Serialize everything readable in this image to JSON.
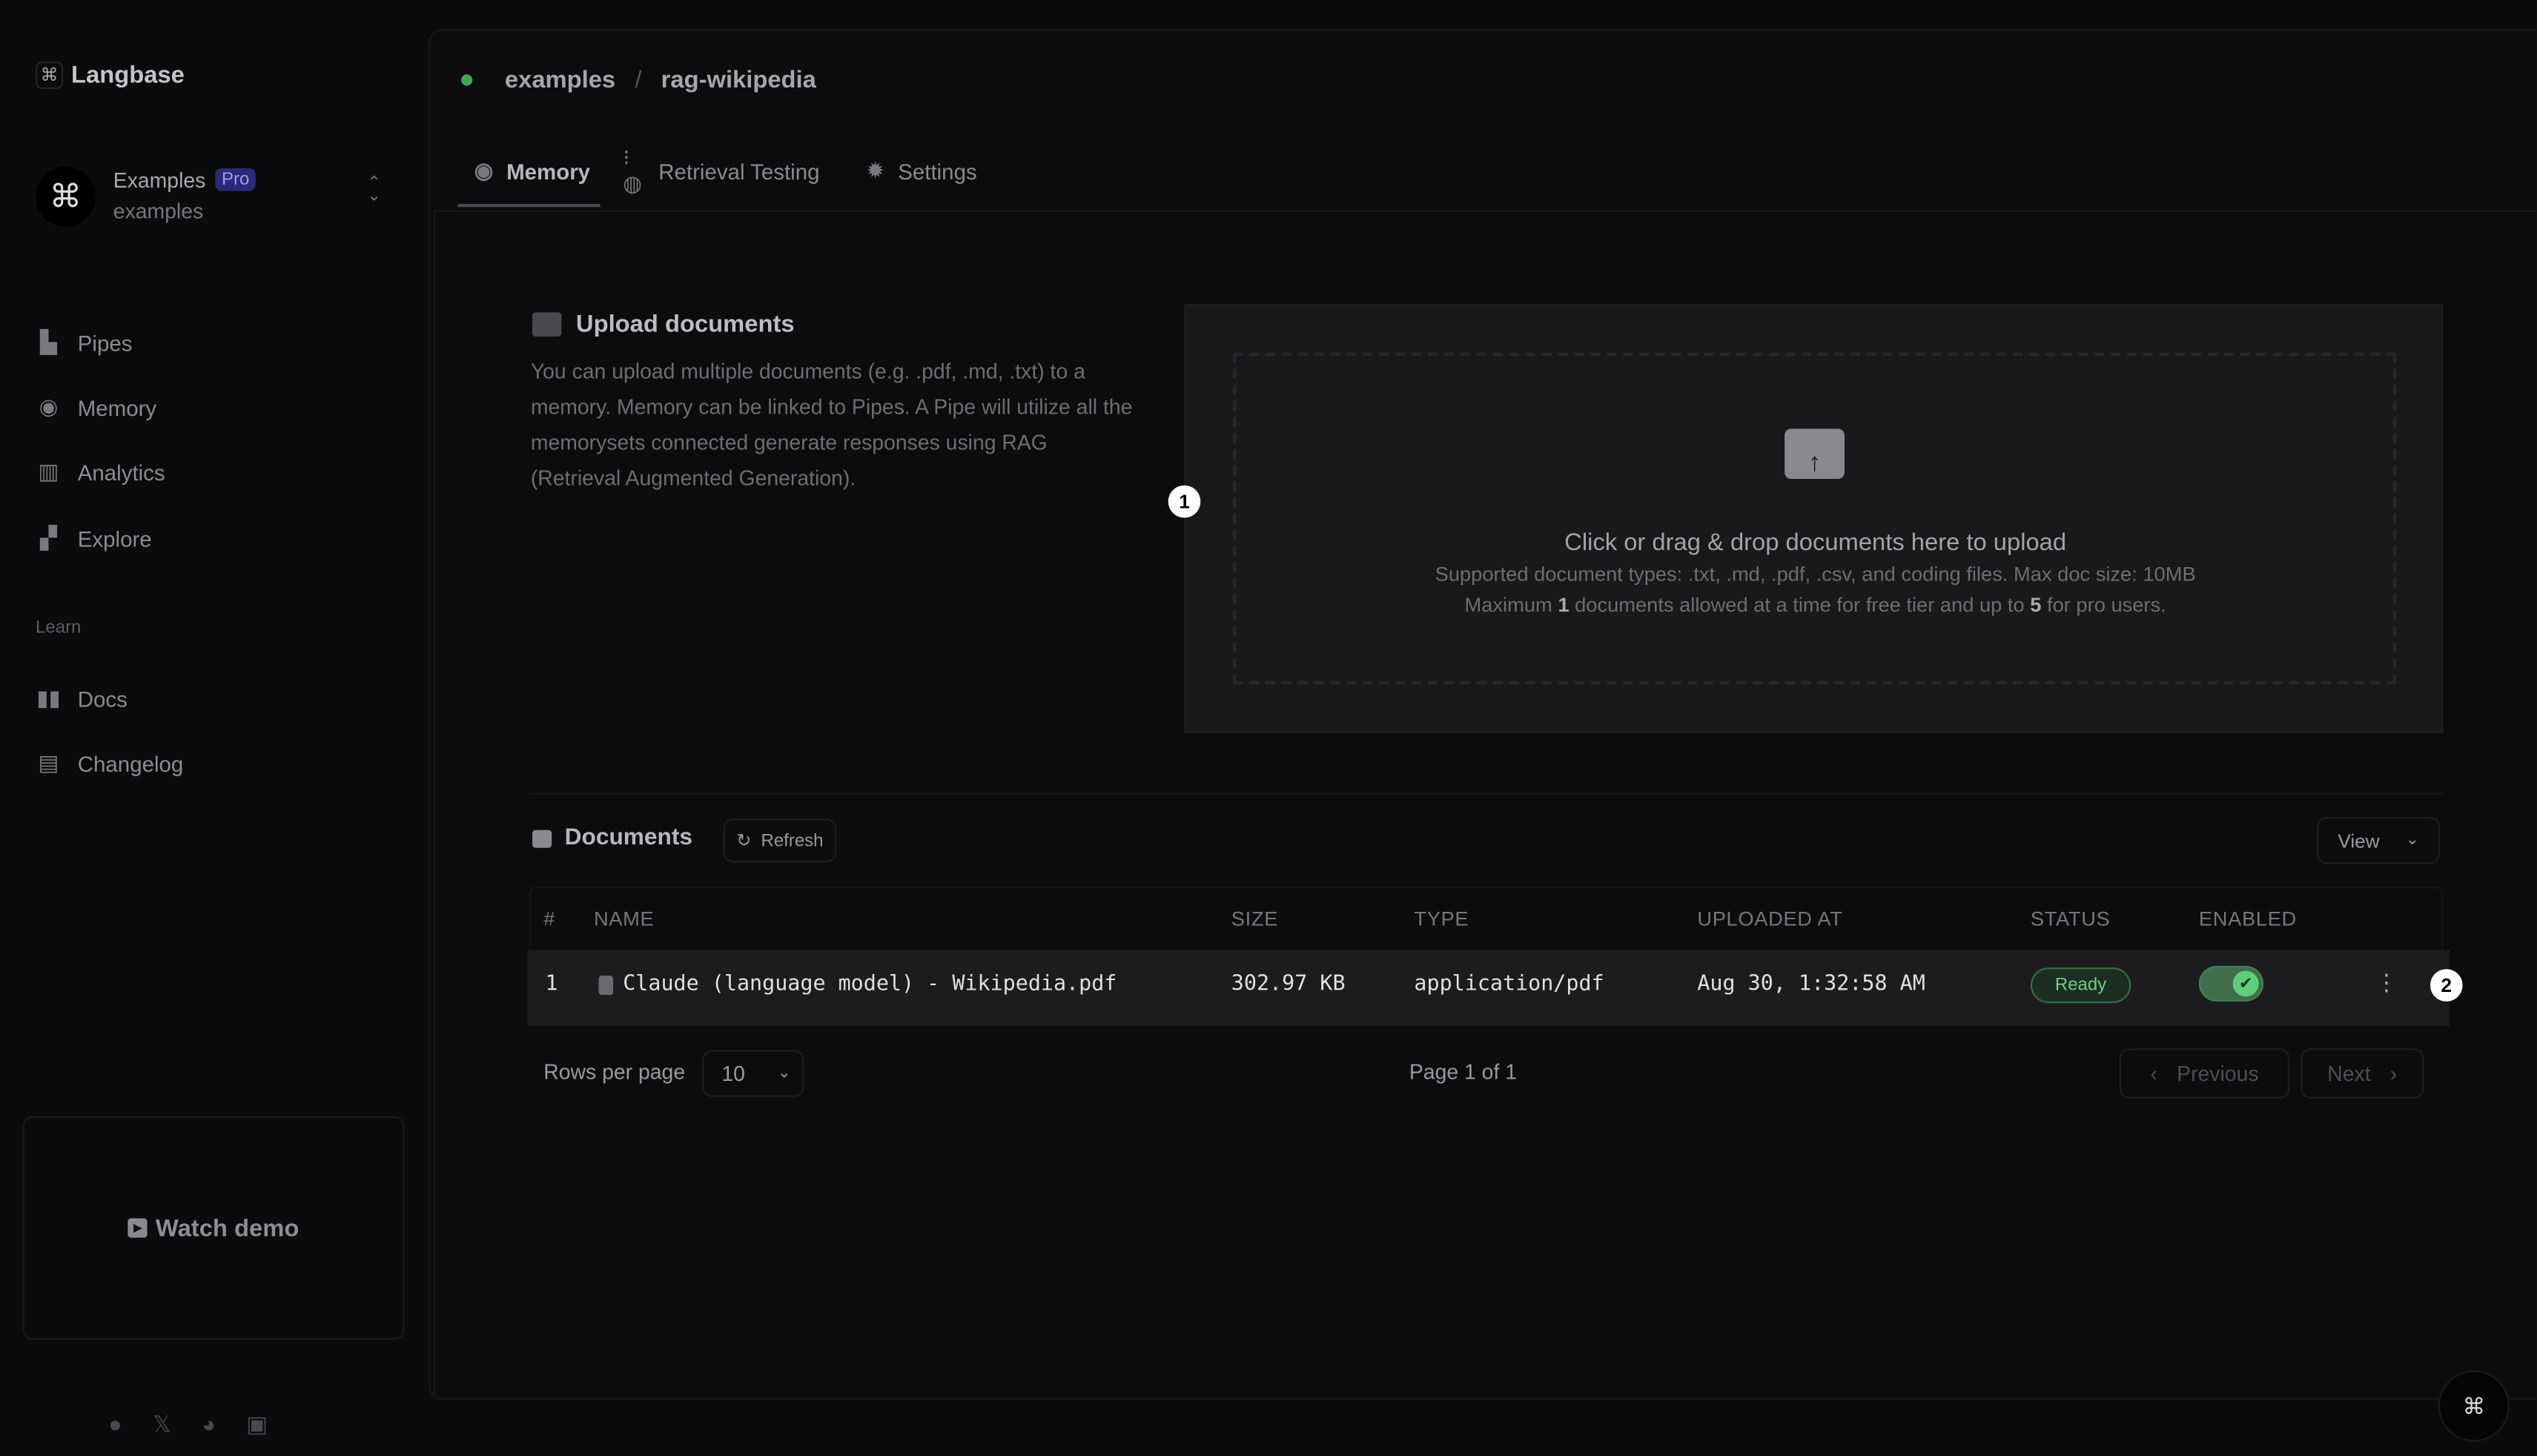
{
  "brand": {
    "name": "Langbase"
  },
  "workspace": {
    "name": "Examples",
    "badge": "Pro",
    "slug": "examples"
  },
  "sidebar": {
    "items": [
      {
        "label": "Pipes",
        "icon": "pipes-icon"
      },
      {
        "label": "Memory",
        "icon": "memory-icon"
      },
      {
        "label": "Analytics",
        "icon": "analytics-icon"
      },
      {
        "label": "Explore",
        "icon": "explore-icon"
      }
    ],
    "learn_label": "Learn",
    "learn_items": [
      {
        "label": "Docs",
        "icon": "docs-icon"
      },
      {
        "label": "Changelog",
        "icon": "changelog-icon"
      }
    ],
    "watch_demo": "Watch demo",
    "footer_icons": [
      "github-icon",
      "x-icon",
      "discord-icon",
      "status-icon"
    ]
  },
  "breadcrumb": {
    "org": "examples",
    "separator": "/",
    "memory": "rag-wikipedia",
    "status_color": "#3fa55a"
  },
  "tabs": [
    {
      "label": "Memory",
      "active": true
    },
    {
      "label": "Retrieval Testing"
    },
    {
      "label": "Settings"
    }
  ],
  "upload": {
    "title": "Upload documents",
    "description": "You can upload multiple documents (e.g. .pdf, .md, .txt) to a memory. Memory can be linked to Pipes. A Pipe will utilize all the memorysets connected generate responses using RAG (Retrieval Augmented Generation).",
    "drop_title": "Click or drag & drop documents here to upload",
    "supported": "Supported document types: .txt, .md, .pdf, .csv, and coding files. Max doc size: 10MB",
    "limit_pre": "Maximum ",
    "limit_free": "1",
    "limit_mid": " documents allowed at a time for free tier and up to ",
    "limit_pro": "5",
    "limit_post": " for pro users."
  },
  "documents": {
    "title": "Documents",
    "refresh": "Refresh",
    "view": "View",
    "columns": [
      "#",
      "NAME",
      "SIZE",
      "TYPE",
      "UPLOADED AT",
      "STATUS",
      "ENABLED"
    ],
    "rows": [
      {
        "index": "1",
        "name": "Claude (language model) - Wikipedia.pdf",
        "size": "302.97 KB",
        "type": "application/pdf",
        "uploaded": "Aug 30, 1:32:58 AM",
        "status": "Ready",
        "enabled": true
      }
    ],
    "rows_per_page_label": "Rows per page",
    "rows_per_page": "10",
    "page_info": "Page 1 of 1",
    "previous": "Previous",
    "next": "Next"
  },
  "annotations": [
    "1",
    "2"
  ],
  "colors": {
    "accent_green": "#5ad07a",
    "pro_badge": "#2b2a7a"
  }
}
